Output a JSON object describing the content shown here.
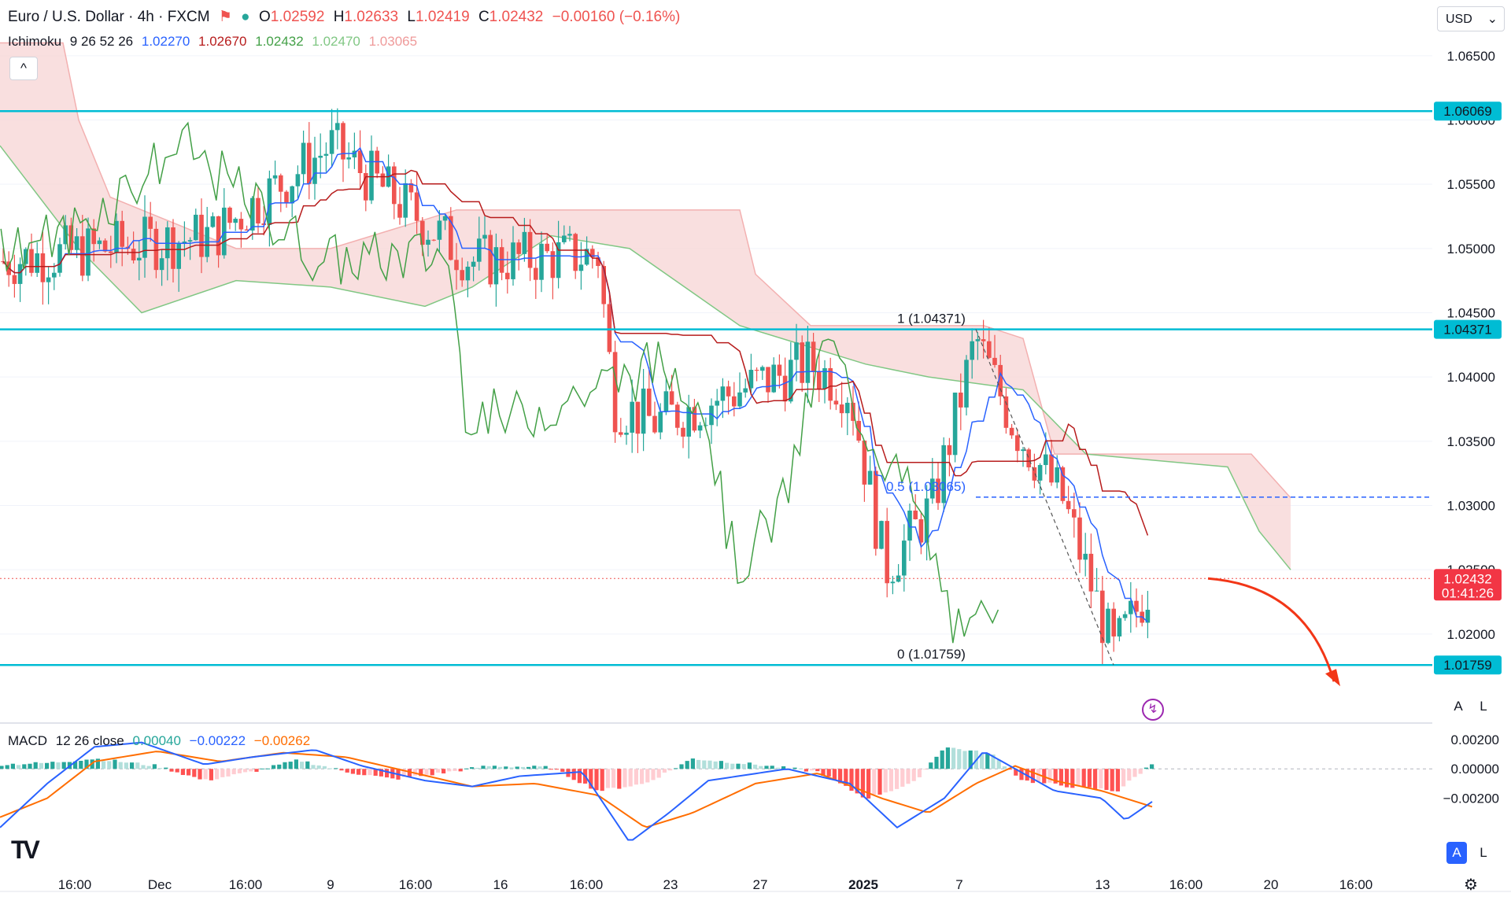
{
  "header": {
    "symbol_title": "Euro / U.S. Dollar · 4h · FXCM",
    "open_label": "O",
    "open": "1.02592",
    "high_label": "H",
    "high": "1.02633",
    "low_label": "L",
    "low": "1.02419",
    "close_label": "C",
    "close": "1.02432",
    "change": "−0.00160 (−0.16%)",
    "currency": "USD"
  },
  "ichimoku": {
    "name": "Ichimoku",
    "params": "9 26 52 26",
    "v1": "1.02270",
    "v2": "1.02670",
    "v3": "1.02432",
    "v4": "1.02470",
    "v5": "1.03065"
  },
  "macd": {
    "name": "MACD",
    "params": "12 26 close",
    "hist": "0.00040",
    "macd": "−0.00222",
    "signal": "−0.00262"
  },
  "price_axis": {
    "ticks": [
      "1.06500",
      "1.06000",
      "1.05500",
      "1.05000",
      "1.04500",
      "1.04000",
      "1.03500",
      "1.03000",
      "1.02500",
      "1.02000"
    ],
    "macd_ticks": [
      "0.00200",
      "0.00000",
      "−0.00200"
    ]
  },
  "price_tags": {
    "resistance_top": "1.06069",
    "resistance_mid": "1.04371",
    "current": "1.02432",
    "countdown": "01:41:26",
    "support": "1.01759"
  },
  "fib_labels": {
    "level_1": "1 (1.04371)",
    "level_05": "0.5 (1.03065)",
    "level_0": "0 (1.01759)"
  },
  "time_axis": [
    "16:00",
    "Dec",
    "16:00",
    "9",
    "16:00",
    "16",
    "16:00",
    "23",
    "27",
    "2025",
    "7",
    "13",
    "16:00",
    "20",
    "16:00"
  ],
  "buttons": {
    "auto": "A",
    "log": "L",
    "auto2": "A",
    "log2": "L",
    "collapse": "^"
  },
  "colors": {
    "level_line": "#00bcd4",
    "up": "#26a69a",
    "down": "#ef5350",
    "tenkan": "#2962ff",
    "kijun": "#b71c1c",
    "lagging": "#43a047",
    "cloud_bear": "#f8d7d7",
    "cloud_bull": "#d7ecd9",
    "projection_arrow": "#f23617",
    "macd_line": "#2962ff",
    "signal_line": "#ff6d00"
  },
  "chart_data": {
    "type": "candlestick",
    "timeframe": "4h",
    "ylim": [
      1.0135,
      1.0675
    ],
    "horizontal_levels": [
      1.06069,
      1.04371,
      1.01759
    ],
    "current_price": 1.02432,
    "fib_retracement": {
      "level_1": 1.04371,
      "level_05": 1.03065,
      "level_0": 1.01759
    },
    "segments": [
      {
        "x_from": 0,
        "x_to": 270,
        "y_from": 1.049,
        "y_to": 1.051
      },
      {
        "x_from": 270,
        "x_to": 420,
        "y_from": 1.051,
        "y_to": 1.058
      },
      {
        "x_from": 420,
        "x_to": 600,
        "y_from": 1.058,
        "y_to": 1.049
      },
      {
        "x_from": 600,
        "x_to": 760,
        "y_from": 1.049,
        "y_to": 1.0495
      },
      {
        "x_from": 760,
        "x_to": 780,
        "y_from": 1.0495,
        "y_to": 1.038
      },
      {
        "x_from": 780,
        "x_to": 830,
        "y_from": 1.038,
        "y_to": 1.0365
      },
      {
        "x_from": 830,
        "x_to": 1030,
        "y_from": 1.0365,
        "y_to": 1.041
      },
      {
        "x_from": 1030,
        "x_to": 1080,
        "y_from": 1.041,
        "y_to": 1.039
      },
      {
        "x_from": 1080,
        "x_to": 1125,
        "y_from": 1.039,
        "y_to": 1.025
      },
      {
        "x_from": 1125,
        "x_to": 1185,
        "y_from": 1.025,
        "y_to": 1.03
      },
      {
        "x_from": 1185,
        "x_to": 1240,
        "y_from": 1.03,
        "y_to": 1.043
      },
      {
        "x_from": 1240,
        "x_to": 1290,
        "y_from": 1.043,
        "y_to": 1.036
      },
      {
        "x_from": 1290,
        "x_to": 1350,
        "y_from": 1.036,
        "y_to": 1.0305
      },
      {
        "x_from": 1350,
        "x_to": 1415,
        "y_from": 1.0305,
        "y_to": 1.0185
      },
      {
        "x_from": 1415,
        "x_to": 1465,
        "y_from": 1.0185,
        "y_to": 1.0243
      }
    ],
    "cloud_top": [
      [
        0,
        1.066
      ],
      [
        80,
        1.066
      ],
      [
        100,
        1.06
      ],
      [
        140,
        1.054
      ],
      [
        300,
        1.05
      ],
      [
        420,
        1.05
      ],
      [
        580,
        1.053
      ],
      [
        760,
        1.053
      ],
      [
        940,
        1.053
      ],
      [
        960,
        1.048
      ],
      [
        1030,
        1.044
      ],
      [
        1250,
        1.044
      ],
      [
        1300,
        1.043
      ],
      [
        1340,
        1.034
      ],
      [
        1500,
        1.034
      ],
      [
        1590,
        1.034
      ],
      [
        1640,
        1.0306
      ]
    ],
    "cloud_bottom": [
      [
        0,
        1.058
      ],
      [
        100,
        1.05
      ],
      [
        180,
        1.045
      ],
      [
        300,
        1.0475
      ],
      [
        420,
        1.047
      ],
      [
        540,
        1.0455
      ],
      [
        600,
        1.047
      ],
      [
        700,
        1.051
      ],
      [
        800,
        1.05
      ],
      [
        940,
        1.044
      ],
      [
        1100,
        1.041
      ],
      [
        1180,
        1.04
      ],
      [
        1300,
        1.039
      ],
      [
        1380,
        1.034
      ],
      [
        1560,
        1.033
      ],
      [
        1600,
        1.028
      ],
      [
        1640,
        1.025
      ]
    ],
    "macd_ylim": [
      -0.0068,
      0.0035
    ],
    "macd_hist_anchors": [
      [
        0,
        0.0003
      ],
      [
        60,
        0.0004
      ],
      [
        120,
        0.0007
      ],
      [
        200,
        0.0002
      ],
      [
        260,
        -0.0008
      ],
      [
        320,
        -0.0002
      ],
      [
        380,
        0.0006
      ],
      [
        440,
        -0.0002
      ],
      [
        500,
        -0.0007
      ],
      [
        560,
        -0.0003
      ],
      [
        620,
        0.0002
      ],
      [
        700,
        0.0001
      ],
      [
        760,
        -0.0015
      ],
      [
        820,
        -0.001
      ],
      [
        880,
        0.0007
      ],
      [
        960,
        0.0003
      ],
      [
        1040,
        -0.0002
      ],
      [
        1100,
        -0.002
      ],
      [
        1160,
        -0.001
      ],
      [
        1200,
        0.0015
      ],
      [
        1260,
        0.001
      ],
      [
        1300,
        -0.0008
      ],
      [
        1360,
        -0.0012
      ],
      [
        1420,
        -0.0015
      ],
      [
        1465,
        0.0004
      ]
    ],
    "macd_line_anchors": [
      [
        0,
        -0.004
      ],
      [
        60,
        -0.001
      ],
      [
        120,
        0.0015
      ],
      [
        180,
        0.0018
      ],
      [
        260,
        0.0003
      ],
      [
        320,
        0.0008
      ],
      [
        400,
        0.0013
      ],
      [
        460,
        0.0002
      ],
      [
        540,
        -0.0008
      ],
      [
        600,
        -0.0012
      ],
      [
        660,
        -0.0005
      ],
      [
        740,
        -0.0002
      ],
      [
        800,
        -0.005
      ],
      [
        850,
        -0.003
      ],
      [
        900,
        -0.0008
      ],
      [
        1000,
        0.0
      ],
      [
        1080,
        -0.001
      ],
      [
        1140,
        -0.004
      ],
      [
        1200,
        -0.002
      ],
      [
        1250,
        0.0012
      ],
      [
        1290,
        0.0
      ],
      [
        1340,
        -0.0015
      ],
      [
        1400,
        -0.002
      ],
      [
        1430,
        -0.0035
      ],
      [
        1465,
        -0.0022
      ]
    ],
    "signal_line_anchors": [
      [
        0,
        -0.0033
      ],
      [
        60,
        -0.002
      ],
      [
        120,
        0.0005
      ],
      [
        200,
        0.0012
      ],
      [
        280,
        0.0005
      ],
      [
        360,
        0.0011
      ],
      [
        440,
        0.0008
      ],
      [
        520,
        -0.0002
      ],
      [
        600,
        -0.0012
      ],
      [
        680,
        -0.001
      ],
      [
        760,
        -0.0018
      ],
      [
        820,
        -0.004
      ],
      [
        880,
        -0.003
      ],
      [
        960,
        -0.001
      ],
      [
        1040,
        -0.0003
      ],
      [
        1120,
        -0.002
      ],
      [
        1180,
        -0.003
      ],
      [
        1240,
        -0.001
      ],
      [
        1290,
        0.0002
      ],
      [
        1340,
        -0.0008
      ],
      [
        1400,
        -0.0015
      ],
      [
        1465,
        -0.0026
      ]
    ]
  }
}
